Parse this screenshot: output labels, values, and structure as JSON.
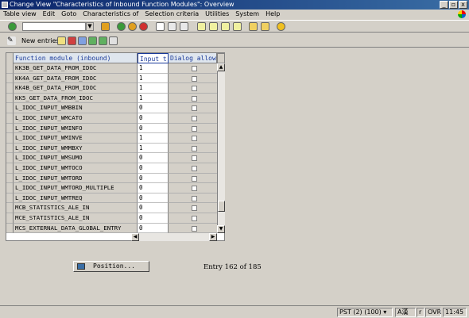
{
  "window": {
    "title": "Change View \"Characteristics of Inbound Function Modules\": Overview",
    "controls": [
      "_",
      "▫",
      "x"
    ]
  },
  "menu": [
    "Table view",
    "Edit",
    "Goto",
    "Characteristics of",
    "Selection criteria",
    "Utilities",
    "System",
    "Help"
  ],
  "toolbar2": {
    "new_entries_label": "New entries"
  },
  "table": {
    "columns": [
      "Function module (inbound)",
      "Input t",
      "Dialog allowed"
    ],
    "rows": [
      {
        "fm": "KK3B_GET_DATA_FROM_IDOC",
        "input": "1"
      },
      {
        "fm": "KK4A_GET_DATA_FROM_IDOC",
        "input": "1"
      },
      {
        "fm": "KK4B_GET_DATA_FROM_IDOC",
        "input": "1"
      },
      {
        "fm": "KK5_GET_DATA_FROM_IDOC",
        "input": "1"
      },
      {
        "fm": "L_IDOC_INPUT_WMBBIN",
        "input": "0"
      },
      {
        "fm": "L_IDOC_INPUT_WMCATO",
        "input": "0"
      },
      {
        "fm": "L_IDOC_INPUT_WMINFO",
        "input": "0"
      },
      {
        "fm": "L_IDOC_INPUT_WMINVE",
        "input": "1"
      },
      {
        "fm": "L_IDOC_INPUT_WMMBXY",
        "input": "1"
      },
      {
        "fm": "L_IDOC_INPUT_WMSUMO",
        "input": "0"
      },
      {
        "fm": "L_IDOC_INPUT_WMTOCO",
        "input": "0"
      },
      {
        "fm": "L_IDOC_INPUT_WMTORD",
        "input": "0"
      },
      {
        "fm": "L_IDOC_INPUT_WMTORD_MULTIPLE",
        "input": "0"
      },
      {
        "fm": "L_IDOC_INPUT_WMTREQ",
        "input": "0"
      },
      {
        "fm": "MCB_STATISTICS_ALE_IN",
        "input": "0"
      },
      {
        "fm": "MCE_STATISTICS_ALE_IN",
        "input": "0"
      },
      {
        "fm": "MCS_EXTERNAL_DATA_GLOBAL_ENTRY",
        "input": "0"
      }
    ]
  },
  "position_button": "Position...",
  "entry_info": "Entry 162 of 185",
  "status": {
    "system": "PST (2) (100)",
    "ime": "A漢",
    "mode1": "r",
    "mode2": "OVR",
    "time": "11:45"
  },
  "colors": {
    "title_start": "#0a246a",
    "title_end": "#3a6ea5",
    "header_text": "#1a3a9a"
  }
}
